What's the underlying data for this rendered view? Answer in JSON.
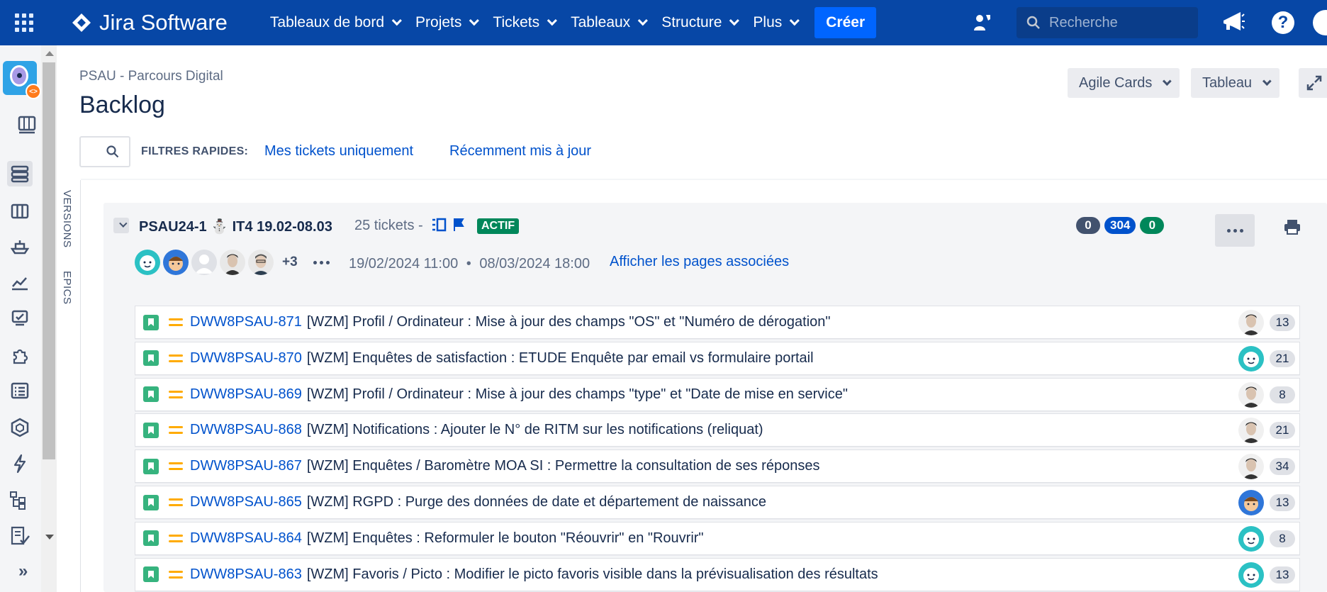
{
  "topnav": {
    "brand": "Jira Software",
    "menu": [
      {
        "label": "Tableaux de bord"
      },
      {
        "label": "Projets"
      },
      {
        "label": "Tickets"
      },
      {
        "label": "Tableaux"
      },
      {
        "label": "Structure"
      },
      {
        "label": "Plus"
      }
    ],
    "create_label": "Créer",
    "search_placeholder": "Recherche"
  },
  "sidebar": {
    "icons": [
      "project-avatar",
      "board-icon",
      "backlog-icon",
      "columns-icon",
      "ship-icon",
      "reports-icon",
      "monitor-icon",
      "puzzle-icon",
      "checklist-icon",
      "package-icon",
      "lightning-icon",
      "hierarchy-icon",
      "document-check-icon",
      "expand-icon"
    ]
  },
  "header": {
    "breadcrumb": "PSAU - Parcours Digital",
    "title": "Backlog",
    "agile_cards_label": "Agile Cards",
    "board_label": "Tableau",
    "quick_filters_label": "FILTRES RAPIDES:",
    "quick_filters": [
      "Mes tickets uniquement",
      "Récemment mis à jour"
    ]
  },
  "side_tabs": [
    "VERSIONS",
    "EPICS"
  ],
  "sprint": {
    "name": "PSAU24-1 ⛄ IT4 19.02-08.03",
    "ticket_count": "25 tickets -",
    "status": "ACTIF",
    "counts": [
      {
        "value": "0",
        "color": "#42526e"
      },
      {
        "value": "304",
        "color": "#0052cc"
      },
      {
        "value": "0",
        "color": "#00875a"
      }
    ],
    "extra_assignees": "+3",
    "start": "19/02/2024 11:00",
    "separator": "•",
    "end": "08/03/2024 18:00",
    "pages_link": "Afficher les pages associées"
  },
  "issues": [
    {
      "key": "DWW8PSAU-871",
      "summary": "[WZM] Profil / Ordinateur : Mise à jour des champs \"OS\" et \"Numéro de dérogation\"",
      "points": "13",
      "avatar": "photo"
    },
    {
      "key": "DWW8PSAU-870",
      "summary": "[WZM] Enquêtes de satisfaction : ETUDE Enquête par email vs formulaire portail",
      "points": "21",
      "avatar": "teal"
    },
    {
      "key": "DWW8PSAU-869",
      "summary": "[WZM] Profil / Ordinateur : Mise à jour des champs \"type\" et \"Date de mise en service\"",
      "points": "8",
      "avatar": "photo"
    },
    {
      "key": "DWW8PSAU-868",
      "summary": "[WZM] Notifications : Ajouter le N° de RITM sur les notifications (reliquat)",
      "points": "21",
      "avatar": "photo"
    },
    {
      "key": "DWW8PSAU-867",
      "summary": "[WZM] Enquêtes / Baromètre MOA SI : Permettre la consultation de ses réponses",
      "points": "34",
      "avatar": "photo"
    },
    {
      "key": "DWW8PSAU-865",
      "summary": "[WZM] RGPD : Purge des données de date et département de naissance",
      "points": "13",
      "avatar": "blue"
    },
    {
      "key": "DWW8PSAU-864",
      "summary": "[WZM] Enquêtes : Reformuler le bouton \"Réouvrir\" en \"Rouvrir\"",
      "points": "8",
      "avatar": "teal"
    },
    {
      "key": "DWW8PSAU-863",
      "summary": "[WZM] Favoris / Picto : Modifier le picto favoris visible dans la prévisualisation des résultats",
      "points": "13",
      "avatar": "teal"
    }
  ]
}
